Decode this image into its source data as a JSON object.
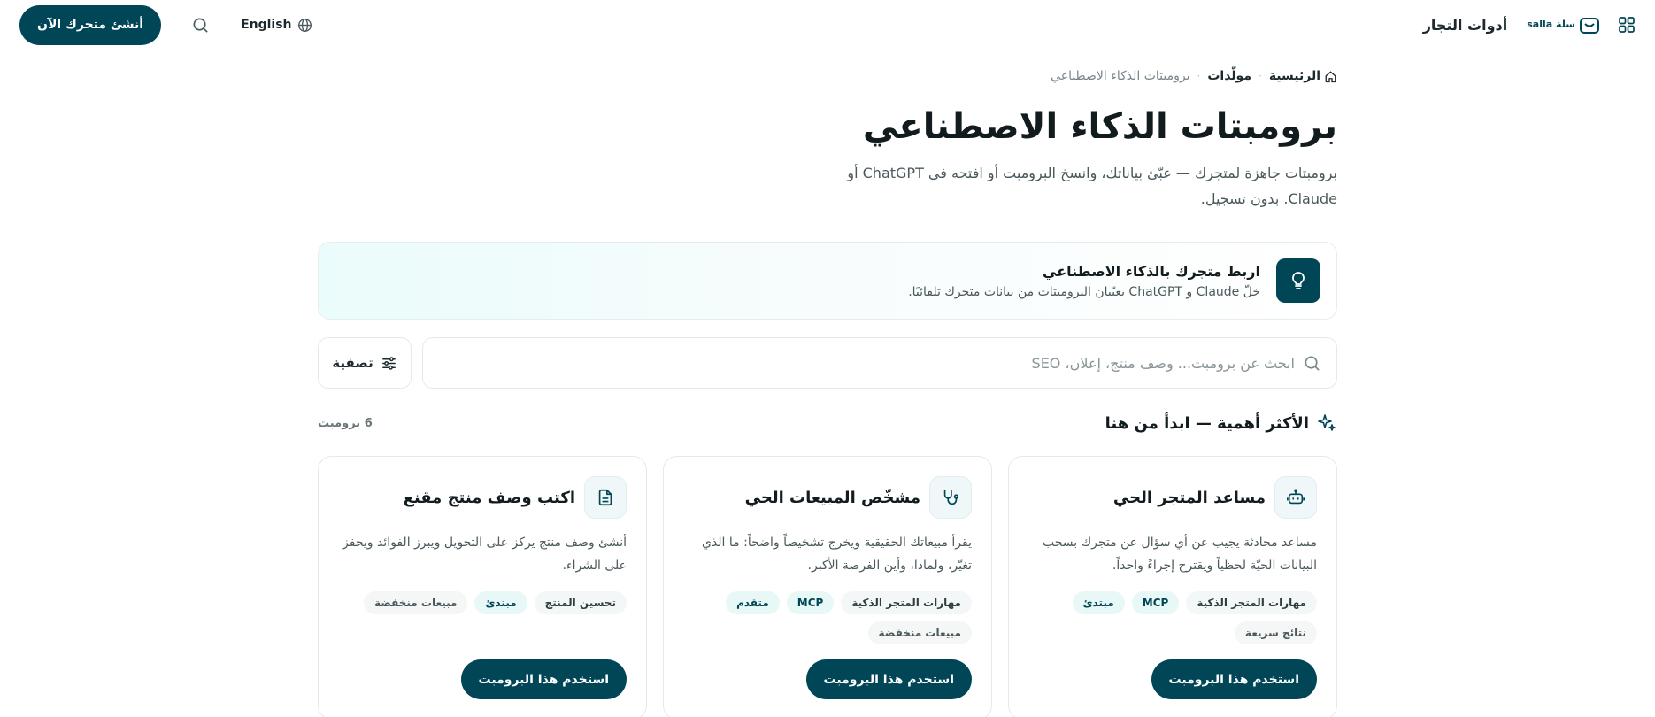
{
  "header": {
    "brand_title": "أدوات التجار",
    "brand_logo_text": "سلة salla",
    "language_label": "English",
    "cta_label": "أنشئ متجرك الآن"
  },
  "breadcrumb": {
    "home": "الرئيسية",
    "middle": "مولّدات",
    "current": "برومبتات الذكاء الاصطناعي"
  },
  "page": {
    "title": "برومبتات الذكاء الاصطناعي",
    "subtitle": "برومبتات جاهزة لمتجرك — عبّئ بياناتك، وانسخ البرومبت أو افتحه في ChatGPT أو Claude. بدون تسجيل."
  },
  "banner": {
    "title": "اربط متجرك بالذكاء الاصطناعي",
    "description": "خلّ Claude و ChatGPT يعبّيان البرومبتات من بيانات متجرك تلقائيًا."
  },
  "search": {
    "placeholder": "ابحث عن برومبت... وصف منتج، إعلان، SEO",
    "filter_label": "تصفية"
  },
  "section": {
    "title": "الأكثر أهمية — ابدأ من هنا",
    "count": "6 برومبت"
  },
  "cards": [
    {
      "icon": "robot-icon",
      "title": "مساعد المتجر الحي",
      "description": "مساعد محادثة يجيب عن أي سؤال عن متجرك بسحب البيانات الحيّة لحظياً ويقترح إجراءً واحداً.",
      "tags": [
        "مهارات المتجر الذكية",
        "MCP",
        "مبتدئ",
        "نتائج سريعة"
      ],
      "button": "استخدم هذا البرومبت"
    },
    {
      "icon": "stethoscope-icon",
      "title": "مشخّص المبيعات الحي",
      "description": "يقرأ مبيعاتك الحقيقية ويخرج تشخيصاً واضحاً: ما الذي تغيّر، ولماذا، وأين الفرصة الأكبر.",
      "tags": [
        "مهارات المتجر الذكية",
        "MCP",
        "متقدم",
        "مبيعات منخفضة"
      ],
      "button": "استخدم هذا البرومبت"
    },
    {
      "icon": "document-icon",
      "title": "اكتب وصف منتج مقنع",
      "description": "أنشئ وصف منتج يركز على التحويل ويبرز الفوائد ويحفز على الشراء.",
      "tags": [
        "تحسين المنتج",
        "مبتدئ",
        "مبيعات منخفضة"
      ],
      "button": "استخدم هذا البرومبت"
    }
  ]
}
